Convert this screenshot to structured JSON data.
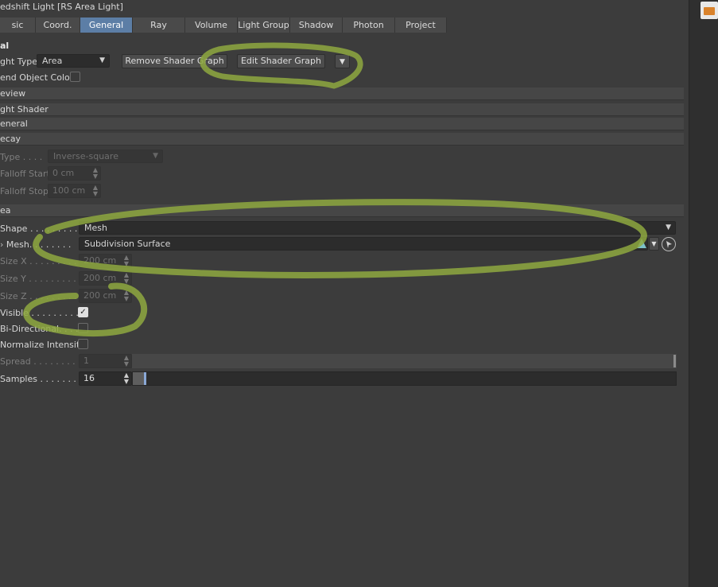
{
  "window": {
    "title": "edshift Light [RS Area Light]"
  },
  "tabs": [
    "sic",
    "Coord.",
    "General",
    "Ray",
    "Volume",
    "Light Group",
    "Shadow",
    "Photon",
    "Project"
  ],
  "active_tab": "General",
  "general": {
    "section_title": "al",
    "light_type_label": "ght Type",
    "light_type_value": "Area",
    "remove_shader_graph": "Remove Shader Graph",
    "edit_shader_graph": "Edit Shader Graph",
    "blend_object_color_label": "end Object Color"
  },
  "groups": {
    "preview": "eview",
    "light_shader": "ght Shader",
    "general": "eneral",
    "decay": "ecay",
    "area": "ea"
  },
  "decay": {
    "type_label": "Type . . . .",
    "type_value": "Inverse-square",
    "falloff_start_label": "Falloff Start",
    "falloff_start_value": "0 cm",
    "falloff_stop_label": "Falloff Stop",
    "falloff_stop_value": "100 cm"
  },
  "area": {
    "shape_label": "Shape . . . . . . . . . .",
    "shape_value": "Mesh",
    "mesh_label": "Mesh. . . . . . . .",
    "mesh_value": "Subdivision Surface",
    "size_x_label": "Size X . . . . . . . . . .",
    "size_x_value": "200 cm",
    "size_y_label": "Size Y . . . . . . . . . .",
    "size_y_value": "200 cm",
    "size_z_label": "Size Z . . . . . . . . . .",
    "size_z_value": "200 cm",
    "visible_label": "Visible . . . . . . . . .",
    "visible_checked": true,
    "bidirectional_label": "Bi-Directional. . . . .",
    "bidirectional_checked": false,
    "normalize_label": "Normalize Intensity",
    "normalize_checked": false,
    "spread_label": "Spread . . . . . . . . .",
    "spread_value": "1",
    "samples_label": "Samples . . . . . . . .",
    "samples_value": "16",
    "samples_slider_level": 0.02,
    "spread_slider_level": 1.0
  },
  "icons": {
    "dropdown": "chevron-down-icon",
    "mesh_expand": "chevron-right-icon",
    "spinner": "spinner-arrows-icon",
    "mesh_link": "mesh-link-icon",
    "pick": "pick-arrow-icon",
    "toolbar_folder": "open-folder-icon"
  },
  "colors": {
    "accent_tab": "#5c7ea6",
    "annotation_stroke": "#8ea83f"
  }
}
